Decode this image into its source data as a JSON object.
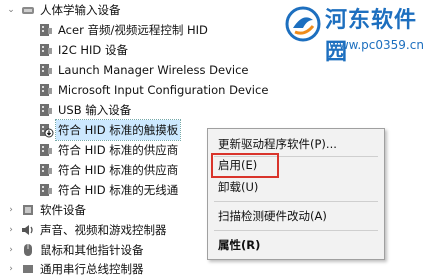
{
  "tree": {
    "category_hid": "人体学输入设备",
    "devices": [
      "Acer 音频/视频远程控制 HID",
      "I2C HID 设备",
      "Launch Manager Wireless Device",
      "Microsoft Input Configuration Device",
      "USB 输入设备",
      "符合 HID 标准的触摸板",
      "符合 HID 标准的供应商",
      "符合 HID 标准的供应商",
      "符合 HID 标准的无线通"
    ],
    "category_software": "软件设备",
    "category_audio": "声音、视频和游戏控制器",
    "category_mouse": "鼠标和其他指针设备",
    "category_partial": "通用串行总线控制器"
  },
  "context_menu": {
    "update_driver": "更新驱动程序软件(P)...",
    "enable": "启用(E)",
    "uninstall": "卸载(U)",
    "scan": "扫描检测硬件改动(A)",
    "properties": "属性(R)"
  },
  "watermark": {
    "title": "河东软件园",
    "url": "www.pc0359.cn"
  },
  "colors": {
    "highlight_border": "#d9342b",
    "watermark": "#1d6fbf"
  }
}
